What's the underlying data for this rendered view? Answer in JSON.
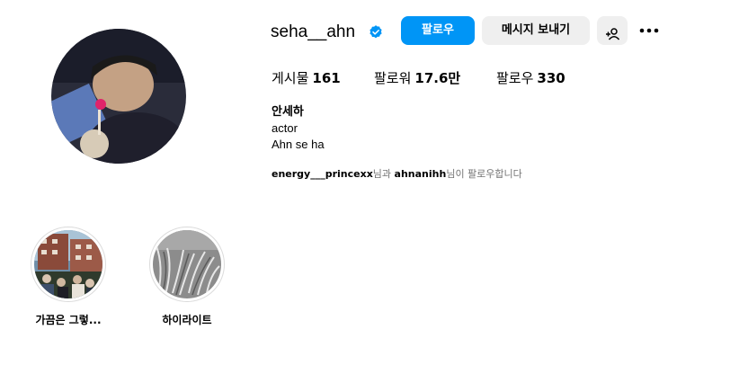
{
  "profile": {
    "username": "seha__ahn",
    "follow_label": "팔로우",
    "message_label": "메시지 보내기",
    "stats": {
      "posts_label": "게시물",
      "posts_value": "161",
      "followers_label": "팔로워",
      "followers_value": "17.6만",
      "following_label": "팔로우",
      "following_value": "330"
    },
    "bio": {
      "name": "안세하",
      "line1": "actor",
      "line2": "Ahn se ha"
    },
    "followed_by": {
      "user1": "energy___princexx",
      "text1": "님과 ",
      "user2": "ahnanihh",
      "text2": "님이 팔로우합니다"
    }
  },
  "highlights": [
    {
      "label": "가끔은 그렇..."
    },
    {
      "label": "하이라이트"
    }
  ],
  "colors": {
    "accent": "#0095f6",
    "secondary_button": "#efefef",
    "muted_text": "#737373"
  },
  "icons": [
    "verified-badge-icon",
    "add-person-icon",
    "more-options-icon"
  ]
}
